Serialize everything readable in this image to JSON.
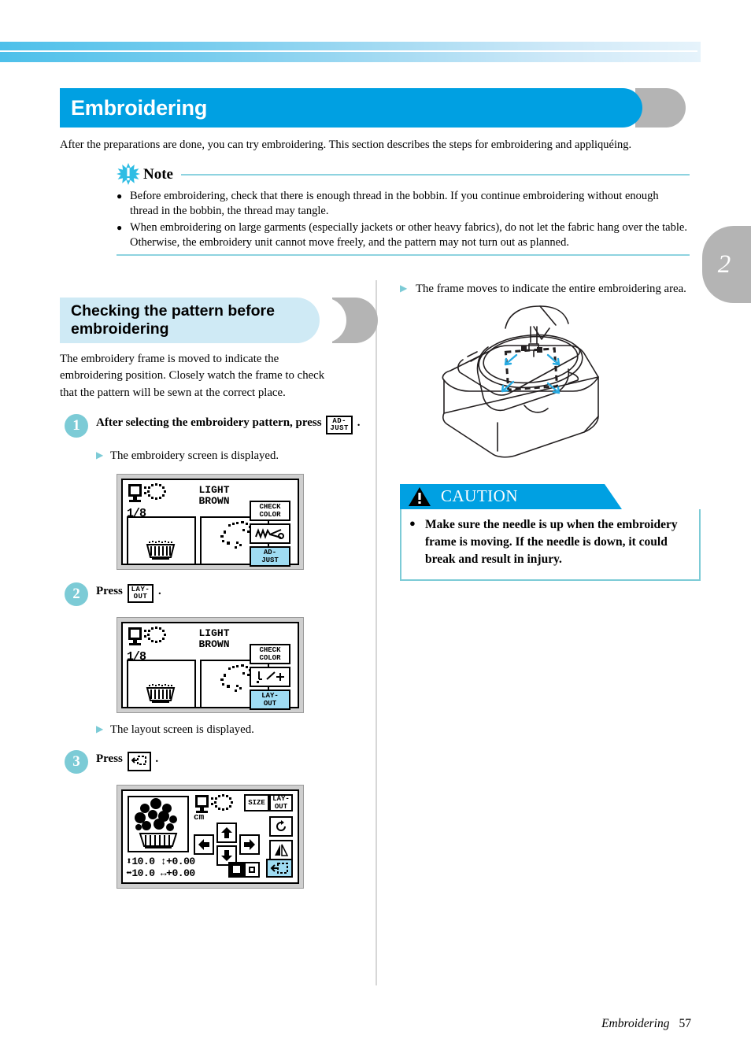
{
  "page": {
    "title": "Embroidering",
    "intro": "After the preparations are done, you can try embroidering. This section describes the steps for embroidering and appliquéing.",
    "chapter_tab": "2",
    "footer_title": "Embroidering",
    "footer_page": "57",
    "accent_blue": "#00a0e2",
    "accent_teal": "#7ccbd6",
    "tab_gray": "#b4b4b4",
    "subhead_blue": "#cfeaf5"
  },
  "note": {
    "title": "Note",
    "icon": "starburst-exclamation-icon",
    "items": [
      "Before embroidering, check that there is enough thread in the bobbin. If you continue embroidering without enough thread in the bobbin, the thread may tangle.",
      "When embroidering on large garments (especially jackets or other heavy fabrics), do not let the fabric hang over the table. Otherwise, the embroidery unit cannot move freely, and the pattern may not turn out as planned."
    ]
  },
  "section": {
    "heading": "Checking the pattern before embroidering",
    "intro": "The embroidery frame is moved to indicate the embroidering position. Closely watch the frame to check that the pattern will be sewn at the correct place."
  },
  "steps": [
    {
      "number": "1",
      "text_before": "After selecting the embroidery pattern, press",
      "key": {
        "line1": "AD-",
        "line2": "JUST"
      },
      "text_after": ".",
      "result": "The embroidery screen is displayed."
    },
    {
      "number": "2",
      "text_before": "Press",
      "key": {
        "line1": "LAY-",
        "line2": "OUT"
      },
      "text_after": ".",
      "result": "The layout screen is displayed."
    },
    {
      "number": "3",
      "text_before": "Press",
      "key": {
        "line1": "trial-position-icon",
        "line2": ""
      },
      "text_after": ".",
      "result": ""
    }
  ],
  "lcd_screen_1": {
    "name": "embroidery-screen",
    "stitch_count": "1/8",
    "thread_color_line1": "LIGHT",
    "thread_color_line2": "BROWN",
    "keys": [
      {
        "line1": "CHECK",
        "line2": "COLOR",
        "highlighted": false
      },
      {
        "line1": "thread-cut-icon",
        "line2": "",
        "highlighted": false
      },
      {
        "line1": "AD-",
        "line2": "JUST",
        "highlighted": true
      }
    ],
    "left_pane_icon": "basket-pattern-icon",
    "right_pane_icon": "stitch-preview-icon",
    "header_icon": "frame-and-pattern-icon"
  },
  "lcd_screen_2": {
    "name": "embroidery-screen-layout-key",
    "stitch_count": "1/8",
    "thread_color_line1": "LIGHT",
    "thread_color_line2": "BROWN",
    "keys": [
      {
        "line1": "CHECK",
        "line2": "COLOR",
        "highlighted": false
      },
      {
        "line1": "needle-position-icon",
        "line2": "",
        "highlighted": false
      },
      {
        "line1": "LAY-",
        "line2": "OUT",
        "highlighted": true
      }
    ],
    "left_pane_icon": "basket-pattern-icon",
    "right_pane_icon": "stitch-preview-icon",
    "header_icon": "frame-and-pattern-icon"
  },
  "lcd_screen_3": {
    "name": "layout-screen",
    "unit": "cm",
    "size_height": "10.0",
    "size_width": "10.0",
    "offset_vertical": "+0.00",
    "offset_horizontal": "+0.00",
    "keys": [
      {
        "label": "SIZE",
        "highlighted": false
      },
      {
        "line1": "LAY-",
        "line2": "OUT",
        "highlighted": false
      },
      {
        "label": "rotate-icon",
        "highlighted": false
      },
      {
        "label": "mirror-icon",
        "highlighted": false
      },
      {
        "label": "trial-position-icon",
        "highlighted": true
      }
    ],
    "arrow_keys": [
      "arrow-up-icon",
      "arrow-down-icon",
      "arrow-left-icon",
      "arrow-right-icon"
    ],
    "pattern_icon": "basket-pattern-icon",
    "header_icon": "frame-and-pattern-icon"
  },
  "right_column": {
    "result": "The frame moves to indicate the entire embroidering area.",
    "figure": "embroidery-unit-with-frame-illustration"
  },
  "caution": {
    "label": "CAUTION",
    "icon": "warning-triangle-icon",
    "text": "Make sure the needle is up when the embroidery frame is moving. If the needle is down, it could break and result in injury."
  }
}
